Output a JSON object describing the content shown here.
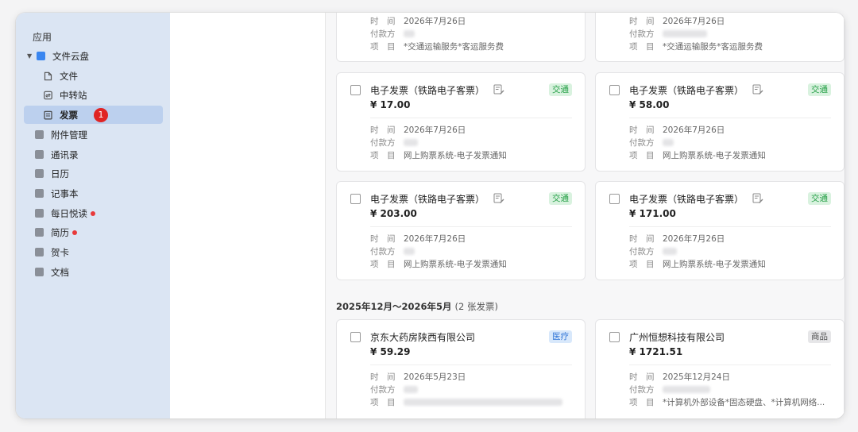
{
  "sidebar": {
    "section_title": "应用",
    "items": [
      {
        "label": "文件云盘"
      },
      {
        "label": "文件"
      },
      {
        "label": "中转站"
      },
      {
        "label": "发票",
        "badge": "1"
      },
      {
        "label": "附件管理"
      },
      {
        "label": "通讯录"
      },
      {
        "label": "日历"
      },
      {
        "label": "记事本"
      },
      {
        "label": "每日悦读"
      },
      {
        "label": "简历"
      },
      {
        "label": "贺卡"
      },
      {
        "label": "文档"
      }
    ]
  },
  "labels": {
    "time": "时　间",
    "payer": "付款方",
    "item": "项　目"
  },
  "cards": [
    {
      "date": "2026年7月26日",
      "item": "*交通运输服务*客运服务费"
    },
    {
      "date": "2026年7月26日",
      "item": "*交通运输服务*客运服务费"
    },
    {
      "title": "电子发票（铁路电子客票）",
      "tag": "交通",
      "amount": "¥ 17.00",
      "date": "2026年7月26日",
      "item": "网上购票系统-电子发票通知"
    },
    {
      "title": "电子发票（铁路电子客票）",
      "tag": "交通",
      "amount": "¥ 58.00",
      "date": "2026年7月26日",
      "item": "网上购票系统-电子发票通知"
    },
    {
      "title": "电子发票（铁路电子客票）",
      "tag": "交通",
      "amount": "¥ 203.00",
      "date": "2026年7月26日",
      "item": "网上购票系统-电子发票通知"
    },
    {
      "title": "电子发票（铁路电子客票）",
      "tag": "交通",
      "amount": "¥ 171.00",
      "date": "2026年7月26日",
      "item": "网上购票系统-电子发票通知"
    },
    {
      "title": "京东大药房陕西有限公司",
      "tag": "医疗",
      "amount": "¥ 59.29",
      "date": "2026年5月23日",
      "item": ""
    },
    {
      "title": "广州恒想科技有限公司",
      "tag": "商品",
      "amount": "¥ 1721.51",
      "date": "2025年12月24日",
      "item": "*计算机外部设备*固态硬盘、*计算机网络..."
    }
  ],
  "group": {
    "heading": "2025年12月～2026年5月",
    "count": "(2 张发票)"
  },
  "colors": {
    "sidebar_bg": "#dbe5f3",
    "selected_bg": "#bcd0ee",
    "tag_transport": "#27a048",
    "tag_medical": "#2f74d6",
    "badge_red": "#e02424"
  }
}
